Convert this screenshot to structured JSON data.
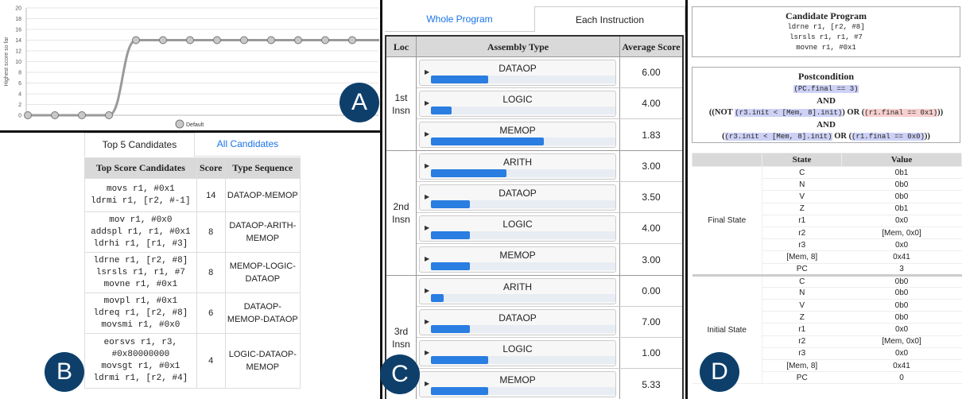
{
  "panel_a": {
    "badge": "A",
    "chart_data": {
      "type": "line",
      "ylabel": "Highest score so far",
      "ylim": [
        0,
        20
      ],
      "yticks": [
        "0",
        "2",
        "4",
        "6",
        "8",
        "10",
        "12",
        "14",
        "16",
        "18",
        "20"
      ],
      "grid": true,
      "legend": "bottom",
      "series": [
        {
          "name": "Default",
          "values": [
            0,
            0,
            0,
            0,
            14,
            14,
            14,
            14,
            14,
            14,
            14,
            14,
            14,
            14
          ]
        }
      ],
      "colors": {
        "line": "#9a9a9a",
        "marker": "#c8c8c8"
      }
    }
  },
  "panel_b": {
    "badge": "B",
    "tabs": [
      "Top 5 Candidates",
      "All Candidates"
    ],
    "headers": [
      "Top Score Candidates",
      "Score",
      "Type Sequence"
    ],
    "rows": [
      {
        "code": "movs r1, #0x1\nldrmi r1, [r2, #-1]",
        "score": "14",
        "seq": "DATAOP-MEMOP"
      },
      {
        "code": "mov r1, #0x0\naddspl r1, r1, #0x1\nldrhi r1, [r1, #3]",
        "score": "8",
        "seq": "DATAOP-ARITH-\nMEMOP"
      },
      {
        "code": "ldrne r1, [r2, #8]\nlsrsls r1, r1, #7\nmovne r1, #0x1",
        "score": "8",
        "seq": "MEMOP-LOGIC-\nDATAOP"
      },
      {
        "code": "movpl r1, #0x1\nldreq r1, [r2, #8]\nmovsmi r1, #0x0",
        "score": "6",
        "seq": "DATAOP-\nMEMOP-DATAOP"
      },
      {
        "code": "eorsvs r1, r3,\n#0x80000000\nmovsgt r1, #0x1\nldrmi r1, [r2, #4]",
        "score": "4",
        "seq": "LOGIC-DATAOP-\nMEMOP"
      }
    ]
  },
  "panel_c": {
    "badge": "C",
    "tabs": [
      "Whole Program",
      "Each Instruction"
    ],
    "headers": [
      "Loc",
      "Assembly Type",
      "Average Score"
    ],
    "groups": [
      {
        "loc": "1st\nInsn",
        "rows": [
          {
            "type": "DATAOP",
            "bar": 0.31,
            "score": "6.00"
          },
          {
            "type": "LOGIC",
            "bar": 0.11,
            "score": "4.00"
          },
          {
            "type": "MEMOP",
            "bar": 0.61,
            "score": "1.83"
          }
        ]
      },
      {
        "loc": "2nd\nInsn",
        "rows": [
          {
            "type": "ARITH",
            "bar": 0.41,
            "score": "3.00"
          },
          {
            "type": "DATAOP",
            "bar": 0.21,
            "score": "3.50"
          },
          {
            "type": "LOGIC",
            "bar": 0.21,
            "score": "4.00"
          },
          {
            "type": "MEMOP",
            "bar": 0.21,
            "score": "3.00"
          }
        ]
      },
      {
        "loc": "3rd\nInsn",
        "rows": [
          {
            "type": "ARITH",
            "bar": 0.07,
            "score": "0.00"
          },
          {
            "type": "DATAOP",
            "bar": 0.21,
            "score": "7.00"
          },
          {
            "type": "LOGIC",
            "bar": 0.31,
            "score": "1.00"
          },
          {
            "type": "MEMOP",
            "bar": 0.31,
            "score": "5.33"
          }
        ]
      }
    ]
  },
  "panel_d": {
    "badge": "D",
    "candidate_title": "Candidate Program",
    "candidate_lines": [
      "ldrne r1, [r2, #8]",
      "lsrsls r1, r1, #7",
      "movne r1, #0x1"
    ],
    "post_title": "Postcondition",
    "post": {
      "l1": "(PC.final == 3)",
      "and": "AND",
      "open": "((",
      "not": "NOT",
      "l3a": "(r3.init  < [Mem, 8].init)",
      "mid": ") OR (",
      "l3b": "(r1.final == 0x1)",
      "close": "))",
      "open4": "(",
      "l4a": "(r3.init  < [Mem, 8].init)",
      "or": " OR (",
      "l4b": "(r1.final == 0x0)",
      "close4": "))"
    },
    "headers": [
      "State",
      "Value"
    ],
    "final_label": "Final State",
    "initial_label": "Initial State",
    "final_rows": [
      [
        "C",
        "0b1"
      ],
      [
        "N",
        "0b0"
      ],
      [
        "V",
        "0b0"
      ],
      [
        "Z",
        "0b1"
      ],
      [
        "r1",
        "0x0"
      ],
      [
        "r2",
        "[Mem, 0x0]"
      ],
      [
        "r3",
        "0x0"
      ],
      [
        "[Mem, 8]",
        "0x41"
      ],
      [
        "PC",
        "3"
      ]
    ],
    "initial_rows": [
      [
        "C",
        "0b0"
      ],
      [
        "N",
        "0b0"
      ],
      [
        "V",
        "0b0"
      ],
      [
        "Z",
        "0b0"
      ],
      [
        "r1",
        "0x0"
      ],
      [
        "r2",
        "[Mem, 0x0]"
      ],
      [
        "r3",
        "0x0"
      ],
      [
        "[Mem, 8]",
        "0x41"
      ],
      [
        "PC",
        "0"
      ]
    ]
  }
}
